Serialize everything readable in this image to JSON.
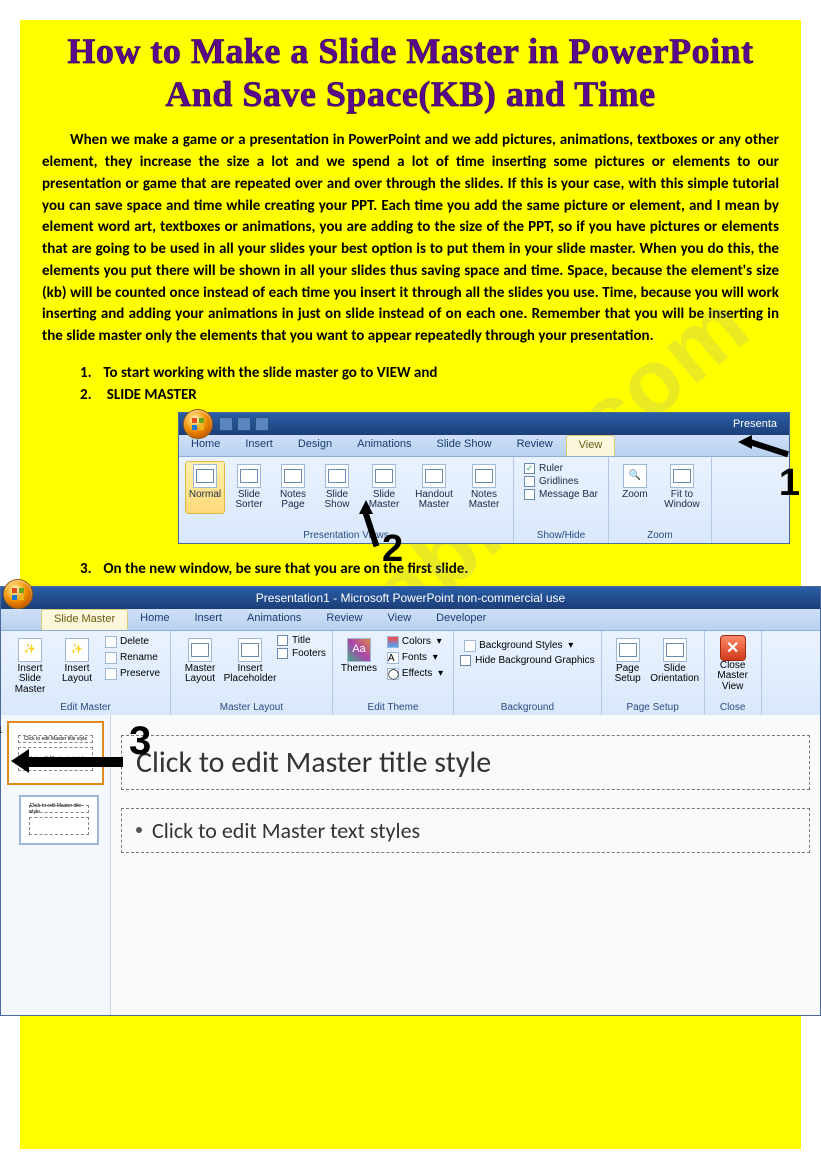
{
  "watermark": "ESLprintables.com",
  "title_line1": "How to Make a Slide Master in PowerPoint",
  "title_line2": "And Save Space(KB) and Time",
  "intro": "When we make a game or a presentation in PowerPoint and we add pictures, animations, textboxes or any other element, they increase the size a lot and we spend a lot of time inserting some pictures or elements to our presentation or game that are repeated over and over through the slides.  If this is your case, with this simple tutorial you can save space and time while creating your PPT. Each time you add the same picture or element, and I mean by element word art, textboxes or animations, you are adding to the size of the PPT, so if you have pictures or elements that are going to be used in all your slides your best option is to put them in your slide master. When you do this, the elements you put there will be shown in all your slides thus saving space and time. Space, because the element's size (kb) will be counted once instead of each time you insert it through all the slides you use. Time, because you will work inserting and adding your animations in just on slide instead of on each one. Remember that you will be inserting in the slide master only the elements that you want to appear repeatedly through your presentation.",
  "steps": {
    "s1": "To start working with the slide master go to VIEW and",
    "s2": "SLIDE MASTER",
    "s3": "On the new window, be sure that you are on the first slide."
  },
  "ribbon1": {
    "app_title": "Presenta",
    "tabs": [
      "Home",
      "Insert",
      "Design",
      "Animations",
      "Slide Show",
      "Review",
      "View"
    ],
    "active_tab": "View",
    "groups": {
      "pres_views": {
        "label": "Presentation Views",
        "buttons": [
          "Normal",
          "Slide Sorter",
          "Notes Page",
          "Slide Show",
          "Slide Master",
          "Handout Master",
          "Notes Master"
        ]
      },
      "showhide": {
        "label": "Show/Hide",
        "items": [
          {
            "label": "Ruler",
            "checked": true
          },
          {
            "label": "Gridlines",
            "checked": false
          },
          {
            "label": "Message Bar",
            "checked": false
          }
        ]
      },
      "zoom": {
        "label": "Zoom",
        "buttons": [
          "Zoom",
          "Fit to Window"
        ]
      }
    },
    "callouts": {
      "one": "1",
      "two": "2"
    }
  },
  "ribbon2": {
    "app_title": "Presentation1 - Microsoft PowerPoint non-commercial use",
    "tabs": [
      "Slide Master",
      "Home",
      "Insert",
      "Animations",
      "Review",
      "View",
      "Developer"
    ],
    "active_tab": "Slide Master",
    "groups": {
      "edit_master": {
        "label": "Edit Master",
        "big": [
          "Insert Slide Master",
          "Insert Layout"
        ],
        "small": [
          "Delete",
          "Rename",
          "Preserve"
        ]
      },
      "master_layout": {
        "label": "Master Layout",
        "big": [
          "Master Layout",
          "Insert Placeholder"
        ],
        "checks": [
          "Title",
          "Footers"
        ]
      },
      "edit_theme": {
        "label": "Edit Theme",
        "big": [
          "Themes"
        ],
        "small": [
          "Colors",
          "Fonts",
          "Effects"
        ]
      },
      "background": {
        "label": "Background",
        "items": [
          "Background Styles",
          "Hide Background Graphics"
        ]
      },
      "page_setup": {
        "label": "Page Setup",
        "buttons": [
          "Page Setup",
          "Slide Orientation"
        ]
      },
      "close": {
        "label": "Close",
        "button": "Close Master View"
      }
    }
  },
  "editor": {
    "callout_three": "3",
    "thumb_num": "1",
    "thumb_title": "Click to edit Master title style",
    "thumb_body": "Click to edit Master text styles",
    "thumb2_title": "Click to edit Master title style",
    "master_title": "Click to edit Master title style",
    "master_body": "Click to edit Master text styles"
  }
}
